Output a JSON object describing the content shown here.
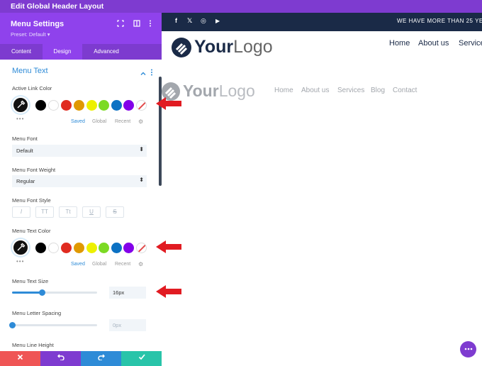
{
  "app": {
    "title": "Edit Global Header Layout"
  },
  "panel": {
    "title": "Menu Settings",
    "preset": "Preset: Default ▾",
    "tabs": [
      "Content",
      "Design",
      "Advanced"
    ],
    "section_title": "Menu Text"
  },
  "active_link_color": {
    "label": "Active Link Color",
    "swatches": [
      "#000000",
      "#ffffff",
      "#e02b20",
      "#e09900",
      "#edf000",
      "#7cda24",
      "#0c71c3",
      "#8300e9"
    ],
    "saved": "Saved",
    "global": "Global",
    "recent": "Recent"
  },
  "menu_font": {
    "label": "Menu Font",
    "value": "Default"
  },
  "menu_font_weight": {
    "label": "Menu Font Weight",
    "value": "Regular"
  },
  "menu_font_style": {
    "label": "Menu Font Style",
    "buttons": [
      "I",
      "TT",
      "Tt",
      "U",
      "S"
    ]
  },
  "menu_text_color": {
    "label": "Menu Text Color",
    "swatches": [
      "#000000",
      "#ffffff",
      "#e02b20",
      "#e09900",
      "#edf000",
      "#7cda24",
      "#0c71c3",
      "#8300e9"
    ],
    "saved": "Saved",
    "global": "Global",
    "recent": "Recent"
  },
  "menu_text_size": {
    "label": "Menu Text Size",
    "value": "16px",
    "level": 0.35
  },
  "menu_letter_spacing": {
    "label": "Menu Letter Spacing",
    "value": "0px",
    "level": 0.0
  },
  "menu_line_height": {
    "label": "Menu Line Height"
  },
  "footer": {
    "colors": [
      "#ef5555",
      "#7e3bd0",
      "#2e8bd7",
      "#29c4a9"
    ]
  },
  "preview": {
    "topbar": {
      "social": [
        "f",
        "𝕏",
        "◎",
        "▶"
      ],
      "announcement": "WE HAVE MORE THAN 25 YE"
    },
    "logo": {
      "strong": "Your",
      "light": "Logo"
    },
    "nav_main": [
      "Home",
      "About us",
      "Service"
    ],
    "nav_secondary": [
      "Home",
      "About us",
      "Services",
      "Blog",
      "Contact"
    ]
  },
  "colors": {
    "accent": "#2e8bd7",
    "purple": "#8f42ec",
    "navy": "#1a2a47",
    "arrow": "#e11b22"
  }
}
